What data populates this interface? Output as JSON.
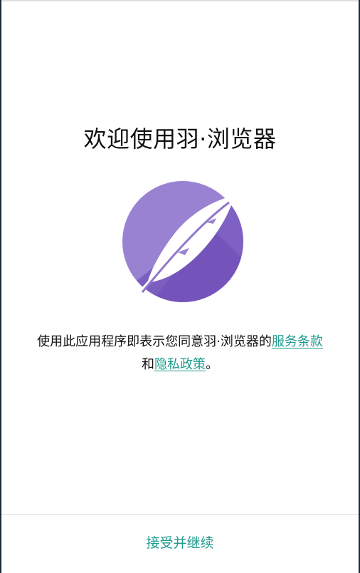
{
  "welcome": {
    "title": "欢迎使用羽·浏览器"
  },
  "logo": {
    "icon": "feather-icon",
    "colors": {
      "circle_light": "#9a82d3",
      "circle_dark": "#6f4fb6",
      "feather": "#ffffff"
    }
  },
  "agreement": {
    "prefix": "使用此应用程序即表示您同意羽·浏览器的",
    "terms_link": "服务条款",
    "connector": "和",
    "privacy_link": "隐私政策",
    "suffix": "。"
  },
  "footer": {
    "accept_label": "接受并继续"
  },
  "theme": {
    "accent": "#1f9b8f",
    "text": "#111111",
    "divider": "#dedede"
  }
}
